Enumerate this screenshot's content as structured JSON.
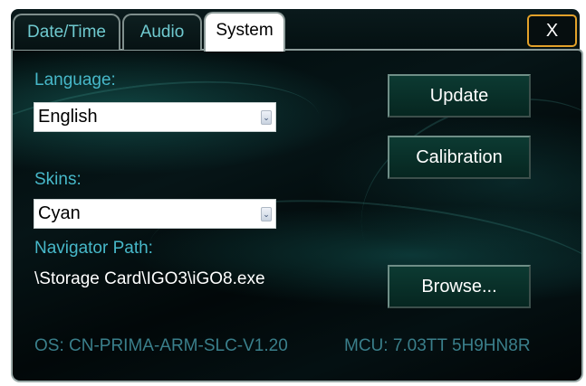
{
  "tabs": [
    {
      "label": "Date/Time",
      "active": false
    },
    {
      "label": "Audio",
      "active": false
    },
    {
      "label": "System",
      "active": true
    }
  ],
  "close_label": "X",
  "language": {
    "label": "Language:",
    "value": "English"
  },
  "skins": {
    "label": "Skins:",
    "value": "Cyan"
  },
  "navigator": {
    "label": "Navigator Path:",
    "path": "\\Storage Card\\IGO3\\iGO8.exe"
  },
  "buttons": {
    "update": "Update",
    "calibration": "Calibration",
    "browse": "Browse..."
  },
  "footer": {
    "os": "OS: CN-PRIMA-ARM-SLC-V1.20",
    "mcu": "MCU: 7.03TT 5H9HN8R"
  },
  "colors": {
    "label_cyan": "#47b8c9",
    "close_border": "#e2a12a",
    "button_fill": "#0c3a32",
    "footer_text": "#3a7f8b"
  }
}
